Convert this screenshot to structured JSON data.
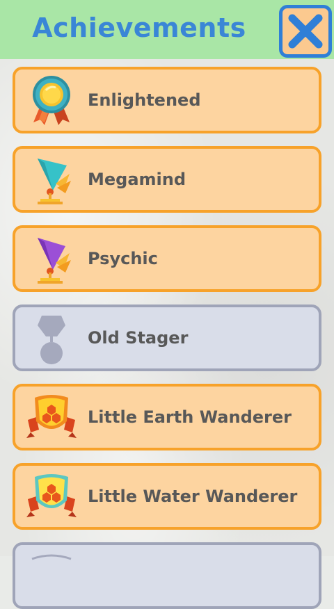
{
  "header": {
    "title": "Achievements",
    "close_icon": "close-icon"
  },
  "achievements": [
    {
      "label": "Enlightened",
      "icon": "medal-ribbon-icon",
      "unlocked": true
    },
    {
      "label": "Megamind",
      "icon": "teal-trophy-icon",
      "unlocked": true
    },
    {
      "label": "Psychic",
      "icon": "purple-trophy-icon",
      "unlocked": true
    },
    {
      "label": "Old Stager",
      "icon": "locked-medal-icon",
      "unlocked": false
    },
    {
      "label": "Little Earth Wanderer",
      "icon": "earth-shield-icon",
      "unlocked": true
    },
    {
      "label": "Little Water Wanderer",
      "icon": "water-shield-icon",
      "unlocked": true
    },
    {
      "label": "",
      "icon": "locked-badge-icon",
      "unlocked": false
    }
  ],
  "colors": {
    "header_bg": "#a9e6a6",
    "title": "#3a86d6",
    "card_unlocked_bg": "#fdd4a0",
    "card_unlocked_border": "#f7a22a",
    "card_locked_bg": "#d9dde9",
    "card_locked_border": "#9fa4b8"
  }
}
